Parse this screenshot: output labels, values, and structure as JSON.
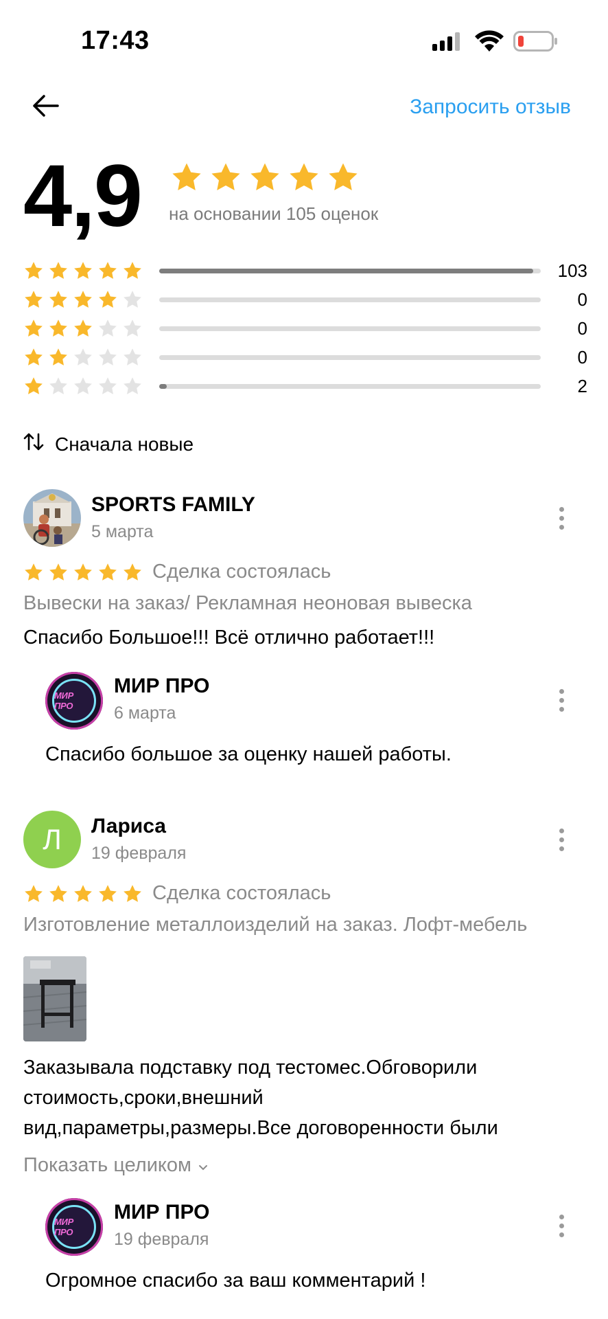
{
  "status_bar": {
    "time": "17:43"
  },
  "header": {
    "request_review_label": "Запросить отзыв"
  },
  "rating": {
    "score": "4,9",
    "summary_stars": 5,
    "caption": "на основании 105 оценок",
    "distribution": [
      {
        "stars": 5,
        "count": "103",
        "fraction": 0.98
      },
      {
        "stars": 4,
        "count": "0",
        "fraction": 0
      },
      {
        "stars": 3,
        "count": "0",
        "fraction": 0
      },
      {
        "stars": 2,
        "count": "0",
        "fraction": 0
      },
      {
        "stars": 1,
        "count": "2",
        "fraction": 0.02
      }
    ]
  },
  "sort": {
    "label": "Сначала новые"
  },
  "reviews": [
    {
      "author": "SPORTS FAMILY",
      "date": "5 марта",
      "stars": 5,
      "deal_status": "Сделка состоялась",
      "category": "Вывески на заказ/ Рекламная неоновая вывеска",
      "text": "Спасибо Большое!!! Всё отлично работает!!!",
      "reply": {
        "author": "МИР ПРО",
        "date": "6 марта",
        "logo_text": "МИР ПРО",
        "text": "Спасибо большое за оценку нашей работы."
      }
    },
    {
      "author": "Лариса",
      "avatar_letter": "Л",
      "date": "19 февраля",
      "stars": 5,
      "deal_status": "Сделка состоялась",
      "category": "Изготовление металлоизделий на заказ. Лофт-мебель",
      "text_lines": [
        "Заказывала подставку под тестомес.Обговорили",
        "стоимость,сроки,внешний",
        "вид,параметры,размеры.Все договоренности были"
      ],
      "show_more_label": "Показать целиком",
      "reply": {
        "author": "МИР ПРО",
        "date": "19 февраля",
        "logo_text": "МИР ПРО",
        "text": "Огромное спасибо за ваш комментарий !"
      }
    }
  ],
  "colors": {
    "accent": "#2a9ff0",
    "star": "#f9b82b",
    "star_empty": "#e3e3e3",
    "bar_fill": "#7d7d7d",
    "bar_track": "#dcdcdc",
    "avatar_green": "#8fd04f",
    "battery_red": "#f0443a"
  }
}
